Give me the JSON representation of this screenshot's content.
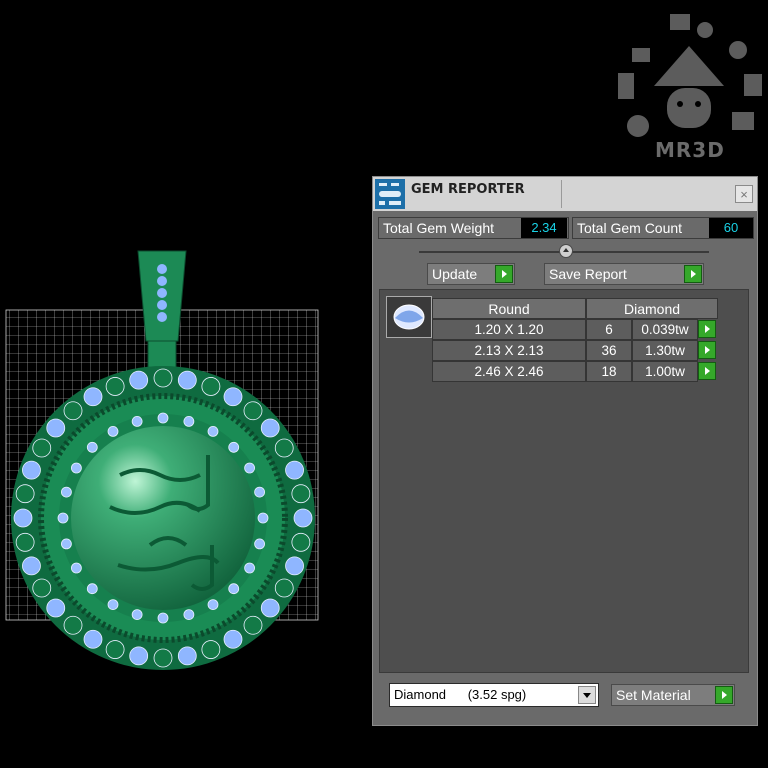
{
  "watermark": {
    "brand": "MR3D"
  },
  "dialog": {
    "title": "GEM REPORTER",
    "close_label": "×",
    "total_weight_label": "Total Gem Weight",
    "total_weight_value": "2.34",
    "total_count_label": "Total Gem Count",
    "total_count_value": "60",
    "update_label": "Update",
    "save_report_label": "Save Report",
    "table": {
      "headers": [
        "Round",
        "Diamond"
      ],
      "rows": [
        {
          "size": "1.20 X 1.20",
          "count": "6",
          "weight": "0.039tw"
        },
        {
          "size": "2.13 X 2.13",
          "count": "36",
          "weight": "1.30tw"
        },
        {
          "size": "2.46 X 2.46",
          "count": "18",
          "weight": "1.00tw"
        }
      ]
    },
    "material_select": "Diamond      (3.52 spg)",
    "set_material_label": "Set Material"
  },
  "colors": {
    "accent_go": "#35a82a",
    "value_text": "#19d2e6",
    "model_green": "#1e8f5a",
    "gem_blue": "#8fb6ff"
  },
  "icons": [
    "gem-reporter-app-icon",
    "close-icon",
    "slider-thumb-icon",
    "play-arrow-icon",
    "round-gem-icon",
    "dropdown-arrow-icon"
  ]
}
